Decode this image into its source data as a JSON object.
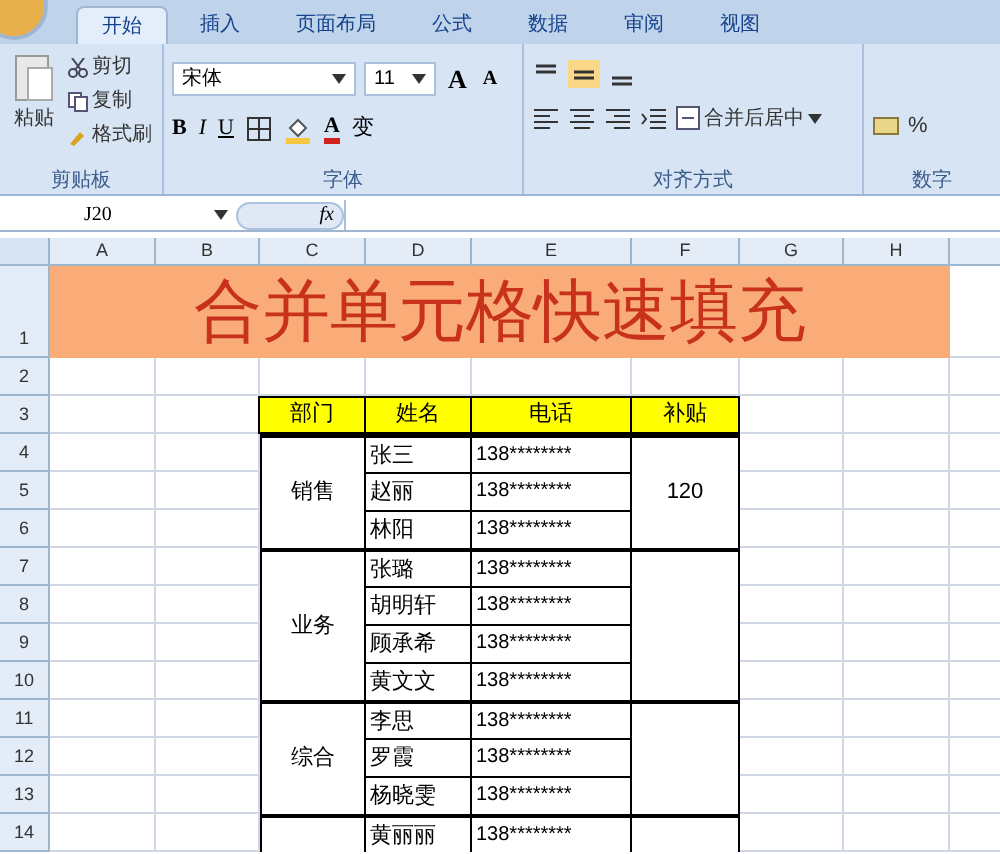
{
  "ribbon": {
    "tabs": [
      {
        "label": "开始",
        "selected": true
      },
      {
        "label": "插入",
        "selected": false
      },
      {
        "label": "页面布局",
        "selected": false
      },
      {
        "label": "公式",
        "selected": false
      },
      {
        "label": "数据",
        "selected": false
      },
      {
        "label": "审阅",
        "selected": false
      },
      {
        "label": "视图",
        "selected": false
      }
    ],
    "clipboard": {
      "paste": "粘贴",
      "cut": "剪切",
      "copy": "复制",
      "format_painter": "格式刷",
      "group": "剪贴板"
    },
    "font": {
      "name": "宋体",
      "size": "11",
      "grow": "A",
      "shrink": "A",
      "bold": "B",
      "italic": "I",
      "underline": "U",
      "font_color": "A",
      "phonetic": "变",
      "group": "字体"
    },
    "alignment": {
      "merge": "合并后居中",
      "group": "对齐方式"
    },
    "number": {
      "percent": "%",
      "group": "数字"
    }
  },
  "formula_bar": {
    "name_box": "J20",
    "fx": "fx"
  },
  "column_headers": [
    "A",
    "B",
    "C",
    "D",
    "E",
    "F",
    "G",
    "H"
  ],
  "row_headers": [
    "1",
    "2",
    "3",
    "4",
    "5",
    "6",
    "7",
    "8",
    "9",
    "10",
    "11",
    "12",
    "13",
    "14"
  ],
  "title": "合并单元格快速填充",
  "table": {
    "columns": [
      "部门",
      "姓名",
      "电话",
      "补贴"
    ],
    "groups": [
      {
        "department": "销售",
        "subsidy": "120",
        "people": [
          {
            "name": "张三",
            "phone": "138********"
          },
          {
            "name": "赵丽",
            "phone": "138********"
          },
          {
            "name": "林阳",
            "phone": "138********"
          }
        ]
      },
      {
        "department": "业务",
        "people": [
          {
            "name": "张璐",
            "phone": "138********"
          },
          {
            "name": "胡明轩",
            "phone": "138********"
          },
          {
            "name": "顾承希",
            "phone": "138********"
          },
          {
            "name": "黄文文",
            "phone": "138********"
          }
        ]
      },
      {
        "department": "综合",
        "people": [
          {
            "name": "李思",
            "phone": "138********"
          },
          {
            "name": "罗霞",
            "phone": "138********"
          },
          {
            "name": "杨晓雯",
            "phone": "138********"
          }
        ]
      },
      {
        "people": [
          {
            "name": "黄丽丽",
            "phone": "138********"
          }
        ]
      }
    ]
  }
}
